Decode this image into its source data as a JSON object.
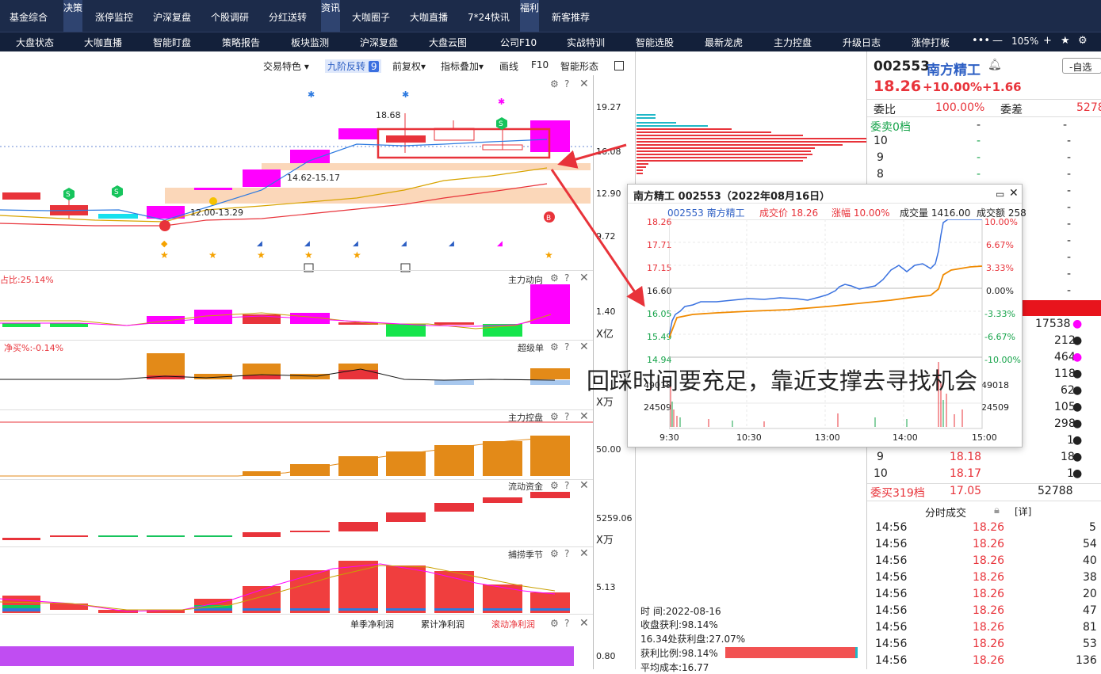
{
  "top_nav": {
    "items": [
      "基金综合",
      "决策",
      "涨停监控",
      "沪深复盘",
      "个股调研",
      "分红送转",
      "资讯",
      "大咖圈子",
      "大咖直播",
      "7*24快讯",
      "福利",
      "新客推荐"
    ]
  },
  "sub_nav": {
    "items": [
      "大盘状态",
      "大咖直播",
      "智能盯盘",
      "策略报告",
      "板块监测",
      "沪深复盘",
      "大盘云图",
      "公司F10",
      "实战特训",
      "智能选股",
      "最新龙虎",
      "主力控盘",
      "升级日志",
      "涨停打板"
    ],
    "zoom": "105%"
  },
  "toolbar": {
    "items": [
      "交易特色 ▾",
      "九阶反转",
      "前复权▾",
      "指标叠加▾",
      "画线",
      "F10",
      "智能形态"
    ],
    "badge": "9"
  },
  "main_chart": {
    "price_labels": [
      "19.27",
      "16.08",
      "12.90",
      "9.72"
    ],
    "annotations": [
      "18.68",
      "14.62-15.17",
      "12.00-13.29"
    ]
  },
  "panels": [
    {
      "title": "主力动向",
      "left": "占比:25.14%",
      "value": "1.40",
      "unit": "X亿"
    },
    {
      "title": "超级单",
      "left": "净买%:-0.14%",
      "value": "",
      "unit": "X万"
    },
    {
      "title": "主力控盘",
      "left": "",
      "value": "50.00",
      "unit": ""
    },
    {
      "title": "流动资金",
      "left": "",
      "value": "5259.06",
      "unit": "X万"
    },
    {
      "title": "捕捞季节",
      "left": "",
      "value": "5.13",
      "unit": ""
    },
    {
      "title": "",
      "left": "",
      "value": "0.80",
      "unit": ""
    }
  ],
  "profit_tabs": [
    "单季净利润",
    "累计净利润",
    "滚动净利润"
  ],
  "chip": {
    "time": "时    间:2022-08-16",
    "profit": "收盘获利:98.14%",
    "profit_at": "16.34处获利盘:27.07%",
    "ratio": "获利比例:98.14%",
    "avg": "平均成本:16.77"
  },
  "quote": {
    "code": "002553",
    "name": "南方精工",
    "button": "-自选",
    "price": "18.26",
    "pct": "+10.00%",
    "change": "+1.66",
    "weibi_label": "委比",
    "weibi": "100.00%",
    "weicha_label": "委差",
    "weicha": "5278",
    "sell_header": "委卖0档",
    "sell_levels": [
      {
        "lv": "10",
        "p": "-",
        "v": "-"
      },
      {
        "lv": "9",
        "p": "-",
        "v": "-"
      },
      {
        "lv": "8",
        "p": "-",
        "v": "-"
      }
    ],
    "buy_rows": [
      {
        "v": "17538"
      },
      {
        "v": "212"
      },
      {
        "v": "464"
      },
      {
        "v": "118"
      },
      {
        "v": "62"
      },
      {
        "v": "105"
      },
      {
        "v": "298"
      },
      {
        "v": "1"
      }
    ],
    "buy_levels": [
      {
        "lv": "9",
        "p": "18.18",
        "v": "18"
      },
      {
        "lv": "10",
        "p": "18.17",
        "v": "1"
      }
    ],
    "buy_total_label": "委买319档",
    "buy_total_price": "17.05",
    "buy_total_vol": "52788",
    "ticks_title": "分时成交",
    "ticks_link": "[详]",
    "ticks": [
      {
        "t": "14:56",
        "p": "18.26",
        "v": "5"
      },
      {
        "t": "14:56",
        "p": "18.26",
        "v": "54"
      },
      {
        "t": "14:56",
        "p": "18.26",
        "v": "40"
      },
      {
        "t": "14:56",
        "p": "18.26",
        "v": "38"
      },
      {
        "t": "14:56",
        "p": "18.26",
        "v": "20"
      },
      {
        "t": "14:56",
        "p": "18.26",
        "v": "47"
      },
      {
        "t": "14:56",
        "p": "18.26",
        "v": "81"
      },
      {
        "t": "14:56",
        "p": "18.26",
        "v": "53"
      },
      {
        "t": "14:56",
        "p": "18.26",
        "v": "136"
      }
    ]
  },
  "popup": {
    "title": "南方精工 002553（2022年08月16日）",
    "code_name": "002553 南方精工",
    "deal": "成交价 18.26",
    "pct": "涨幅 10.00%",
    "vol": "成交量 1416.00",
    "amt": "成交额 258",
    "y_left": [
      "18.26",
      "17.71",
      "17.15",
      "16.60",
      "16.05",
      "15.49",
      "14.94"
    ],
    "y_right": [
      "10.00%",
      "6.67%",
      "3.33%",
      "0.00%",
      "-3.33%",
      "-6.67%",
      "-10.00%"
    ],
    "vol_labels": [
      "49018",
      "24509"
    ],
    "x_labels": [
      "9:30",
      "10:30",
      "13:00",
      "14:00",
      "15:00"
    ]
  },
  "caption": "回踩时间要充足，靠近支撑去寻找机会",
  "colors": {
    "red": "#e8333a",
    "green": "#16c45c",
    "magenta": "#ff00ff",
    "orange": "#dd8a1a",
    "blue": "#3a7ae0",
    "navy": "#1c2b4a"
  }
}
